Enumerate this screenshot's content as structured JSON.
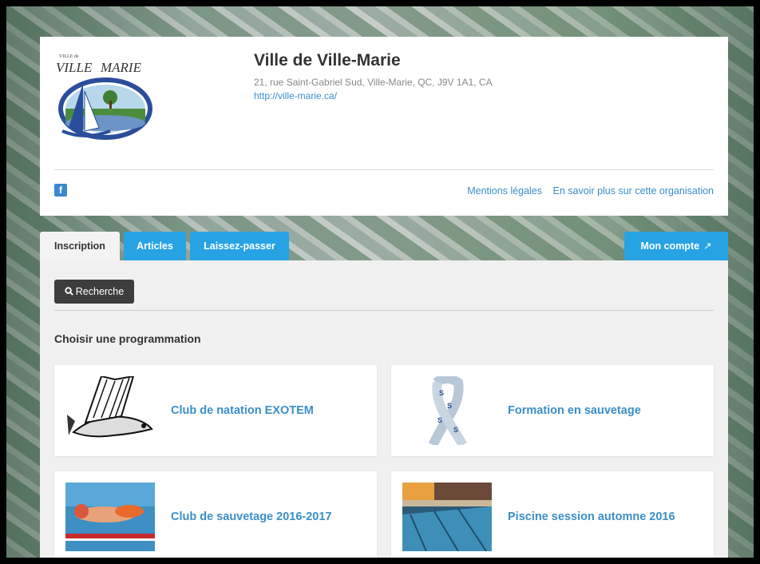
{
  "organization": {
    "name": "Ville de Ville-Marie",
    "address": "21, rue Saint-Gabriel Sud, Ville-Marie, QC, J9V 1A1, CA",
    "url": "http://ville-marie.ca/",
    "logo_text": "VILLE de VILLE MARIE"
  },
  "footer": {
    "facebook_glyph": "f",
    "legal_link": "Mentions légales",
    "about_link": "En savoir plus sur cette organisation"
  },
  "tabs": [
    {
      "label": "Inscription"
    },
    {
      "label": "Articles"
    },
    {
      "label": "Laissez-passer"
    }
  ],
  "account_button": {
    "label": "Mon compte",
    "icon": "external-link-icon"
  },
  "search_button": {
    "label": "Recherche",
    "icon": "search-icon"
  },
  "section_title": "Choisir une programmation",
  "programs": [
    {
      "title": "Club de natation EXOTEM"
    },
    {
      "title": "Formation en sauvetage"
    },
    {
      "title": "Club de sauvetage 2016-2017"
    },
    {
      "title": "Piscine session automne 2016"
    }
  ],
  "colors": {
    "accent_blue": "#27a3e4",
    "link_blue": "#3a8fc7",
    "dark_button": "#3d3d3d"
  }
}
